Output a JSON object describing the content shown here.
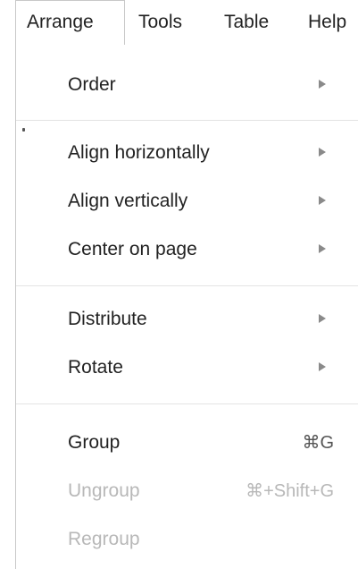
{
  "menubar": {
    "items": [
      {
        "label": "Arrange",
        "active": true
      },
      {
        "label": "Tools"
      },
      {
        "label": "Table"
      },
      {
        "label": "Help"
      }
    ]
  },
  "dropdown": {
    "items": [
      {
        "label": "Order",
        "submenu": true,
        "enabled": true
      },
      {
        "label": "Align horizontally",
        "submenu": true,
        "enabled": true
      },
      {
        "label": "Align vertically",
        "submenu": true,
        "enabled": true
      },
      {
        "label": "Center on page",
        "submenu": true,
        "enabled": true
      },
      {
        "label": "Distribute",
        "submenu": true,
        "enabled": true
      },
      {
        "label": "Rotate",
        "submenu": true,
        "enabled": true
      },
      {
        "label": "Group",
        "shortcut": "⌘G",
        "enabled": true
      },
      {
        "label": "Ungroup",
        "shortcut": "⌘+Shift+G",
        "enabled": false
      },
      {
        "label": "Regroup",
        "enabled": false
      }
    ]
  },
  "icons": {
    "submenu_arrow": "triangle-right-icon"
  },
  "colors": {
    "text": "#222222",
    "disabled_text": "#b8b8b8",
    "arrow": "#8a8a8a",
    "separator": "#e3e3e3",
    "border": "#c8c8c8"
  }
}
